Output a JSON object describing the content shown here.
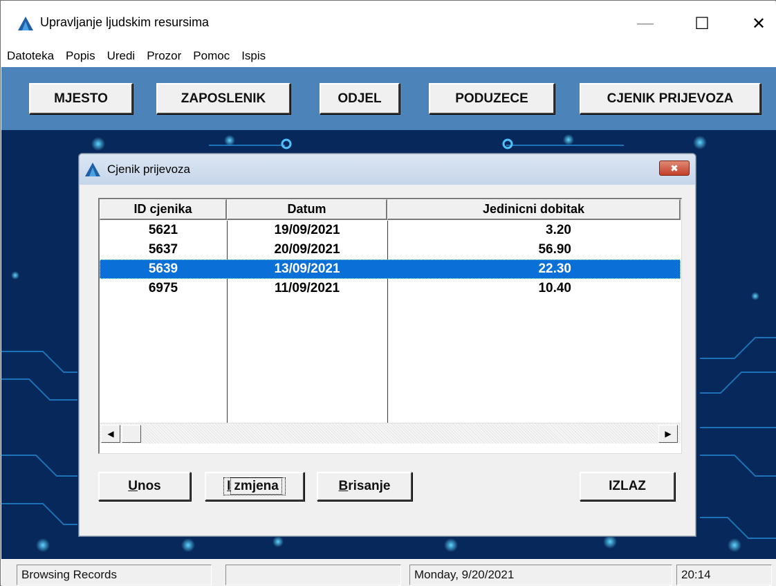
{
  "window": {
    "title": "Upravljanje ljudskim resursima",
    "min_glyph": "—",
    "max_glyph": "☐",
    "close_glyph": "✕"
  },
  "menu": [
    "Datoteka",
    "Popis",
    "Uredi",
    "Prozor",
    "Pomoc",
    "Ispis"
  ],
  "toolbar": {
    "buttons": [
      "MJESTO",
      "ZAPOSLENIK",
      "ODJEL",
      "PODUZECE",
      "CJENIK PRIJEVOZA"
    ]
  },
  "child_window": {
    "title": "Cjenik prijevoza",
    "close_glyph": "✖",
    "grid": {
      "columns": [
        "ID cjenika",
        "Datum",
        "Jedinicni dobitak"
      ],
      "rows": [
        [
          "5621",
          "19/09/2021",
          "3.20"
        ],
        [
          "5637",
          "20/09/2021",
          "56.90"
        ],
        [
          "5639",
          "13/09/2021",
          "22.30"
        ],
        [
          "6975",
          "11/09/2021",
          "10.40"
        ]
      ],
      "selected_row": 2
    },
    "buttons": {
      "unos": {
        "hotkey": "U",
        "rest": "nos"
      },
      "izmjena": {
        "hotkey": "I",
        "rest": "zmjena"
      },
      "brisanje": {
        "hotkey": "B",
        "rest": "risanje"
      },
      "izlaz": "IZLAZ"
    }
  },
  "statusbar": {
    "mode": "Browsing Records",
    "empty": "",
    "date": "Monday,  9/20/2021",
    "time": "20:14"
  },
  "colors": {
    "toolbar": "#4c84b9",
    "selection": "#0a6fd6",
    "desktop": "#06234f"
  }
}
